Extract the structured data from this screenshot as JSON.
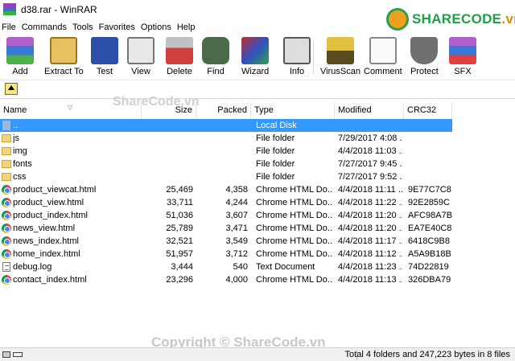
{
  "window": {
    "title": "d38.rar - WinRAR"
  },
  "watermark": {
    "logo_main": "SHARECODE",
    "logo_suffix": ".vn",
    "mid_text": "ShareCode.vn",
    "bottom_text": "Copyright © ShareCode.vn"
  },
  "menu": [
    "File",
    "Commands",
    "Tools",
    "Favorites",
    "Options",
    "Help"
  ],
  "toolbar": [
    {
      "label": "Add",
      "icon": "add-archive-icon"
    },
    {
      "label": "Extract To",
      "icon": "extract-icon"
    },
    {
      "label": "Test",
      "icon": "test-icon"
    },
    {
      "label": "View",
      "icon": "view-icon"
    },
    {
      "label": "Delete",
      "icon": "delete-icon"
    },
    {
      "label": "Find",
      "icon": "find-icon"
    },
    {
      "label": "Wizard",
      "icon": "wizard-icon"
    },
    {
      "label": "Info",
      "icon": "info-icon"
    },
    {
      "label": "VirusScan",
      "icon": "virusscan-icon"
    },
    {
      "label": "Comment",
      "icon": "comment-icon"
    },
    {
      "label": "Protect",
      "icon": "protect-icon"
    },
    {
      "label": "SFX",
      "icon": "sfx-icon"
    }
  ],
  "columns": {
    "name": "Name",
    "size": "Size",
    "packed": "Packed",
    "type": "Type",
    "modified": "Modified",
    "crc": "CRC32"
  },
  "files": [
    {
      "name": "..",
      "size": "",
      "packed": "",
      "type": "Local Disk",
      "modified": "",
      "crc": "",
      "icon": "updir"
    },
    {
      "name": "js",
      "size": "",
      "packed": "",
      "type": "File folder",
      "modified": "7/29/2017 4:08 ...",
      "crc": "",
      "icon": "folder"
    },
    {
      "name": "img",
      "size": "",
      "packed": "",
      "type": "File folder",
      "modified": "4/4/2018 11:03 ...",
      "crc": "",
      "icon": "folder"
    },
    {
      "name": "fonts",
      "size": "",
      "packed": "",
      "type": "File folder",
      "modified": "7/27/2017 9:45 ...",
      "crc": "",
      "icon": "folder"
    },
    {
      "name": "css",
      "size": "",
      "packed": "",
      "type": "File folder",
      "modified": "7/27/2017 9:52 ...",
      "crc": "",
      "icon": "folder"
    },
    {
      "name": "product_viewcat.html",
      "size": "25,469",
      "packed": "4,358",
      "type": "Chrome HTML Do...",
      "modified": "4/4/2018 11:11 ...",
      "crc": "9E77C7C8",
      "icon": "chrome"
    },
    {
      "name": "product_view.html",
      "size": "33,711",
      "packed": "4,244",
      "type": "Chrome HTML Do...",
      "modified": "4/4/2018 11:22 ...",
      "crc": "92E2859C",
      "icon": "chrome"
    },
    {
      "name": "product_index.html",
      "size": "51,036",
      "packed": "3,607",
      "type": "Chrome HTML Do...",
      "modified": "4/4/2018 11:20 ...",
      "crc": "AFC98A7B",
      "icon": "chrome"
    },
    {
      "name": "news_view.html",
      "size": "25,789",
      "packed": "3,471",
      "type": "Chrome HTML Do...",
      "modified": "4/4/2018 11:20 ...",
      "crc": "EA7E40C8",
      "icon": "chrome"
    },
    {
      "name": "news_index.html",
      "size": "32,521",
      "packed": "3,549",
      "type": "Chrome HTML Do...",
      "modified": "4/4/2018 11:17 ...",
      "crc": "6418C9B8",
      "icon": "chrome"
    },
    {
      "name": "home_index.html",
      "size": "51,957",
      "packed": "3,712",
      "type": "Chrome HTML Do...",
      "modified": "4/4/2018 11:12 ...",
      "crc": "A5A9B18B",
      "icon": "chrome"
    },
    {
      "name": "debug.log",
      "size": "3,444",
      "packed": "540",
      "type": "Text Document",
      "modified": "4/4/2018 11:23 ...",
      "crc": "74D22819",
      "icon": "doc"
    },
    {
      "name": "contact_index.html",
      "size": "23,296",
      "packed": "4,000",
      "type": "Chrome HTML Do...",
      "modified": "4/4/2018 11:13 ...",
      "crc": "326DBA79",
      "icon": "chrome"
    }
  ],
  "status": {
    "summary": "Total 4 folders and 247,223 bytes in 8 files"
  },
  "colors": {
    "selection": "#3399ff",
    "watermark_green": "#1f9e47",
    "watermark_orange": "#e08a10"
  }
}
